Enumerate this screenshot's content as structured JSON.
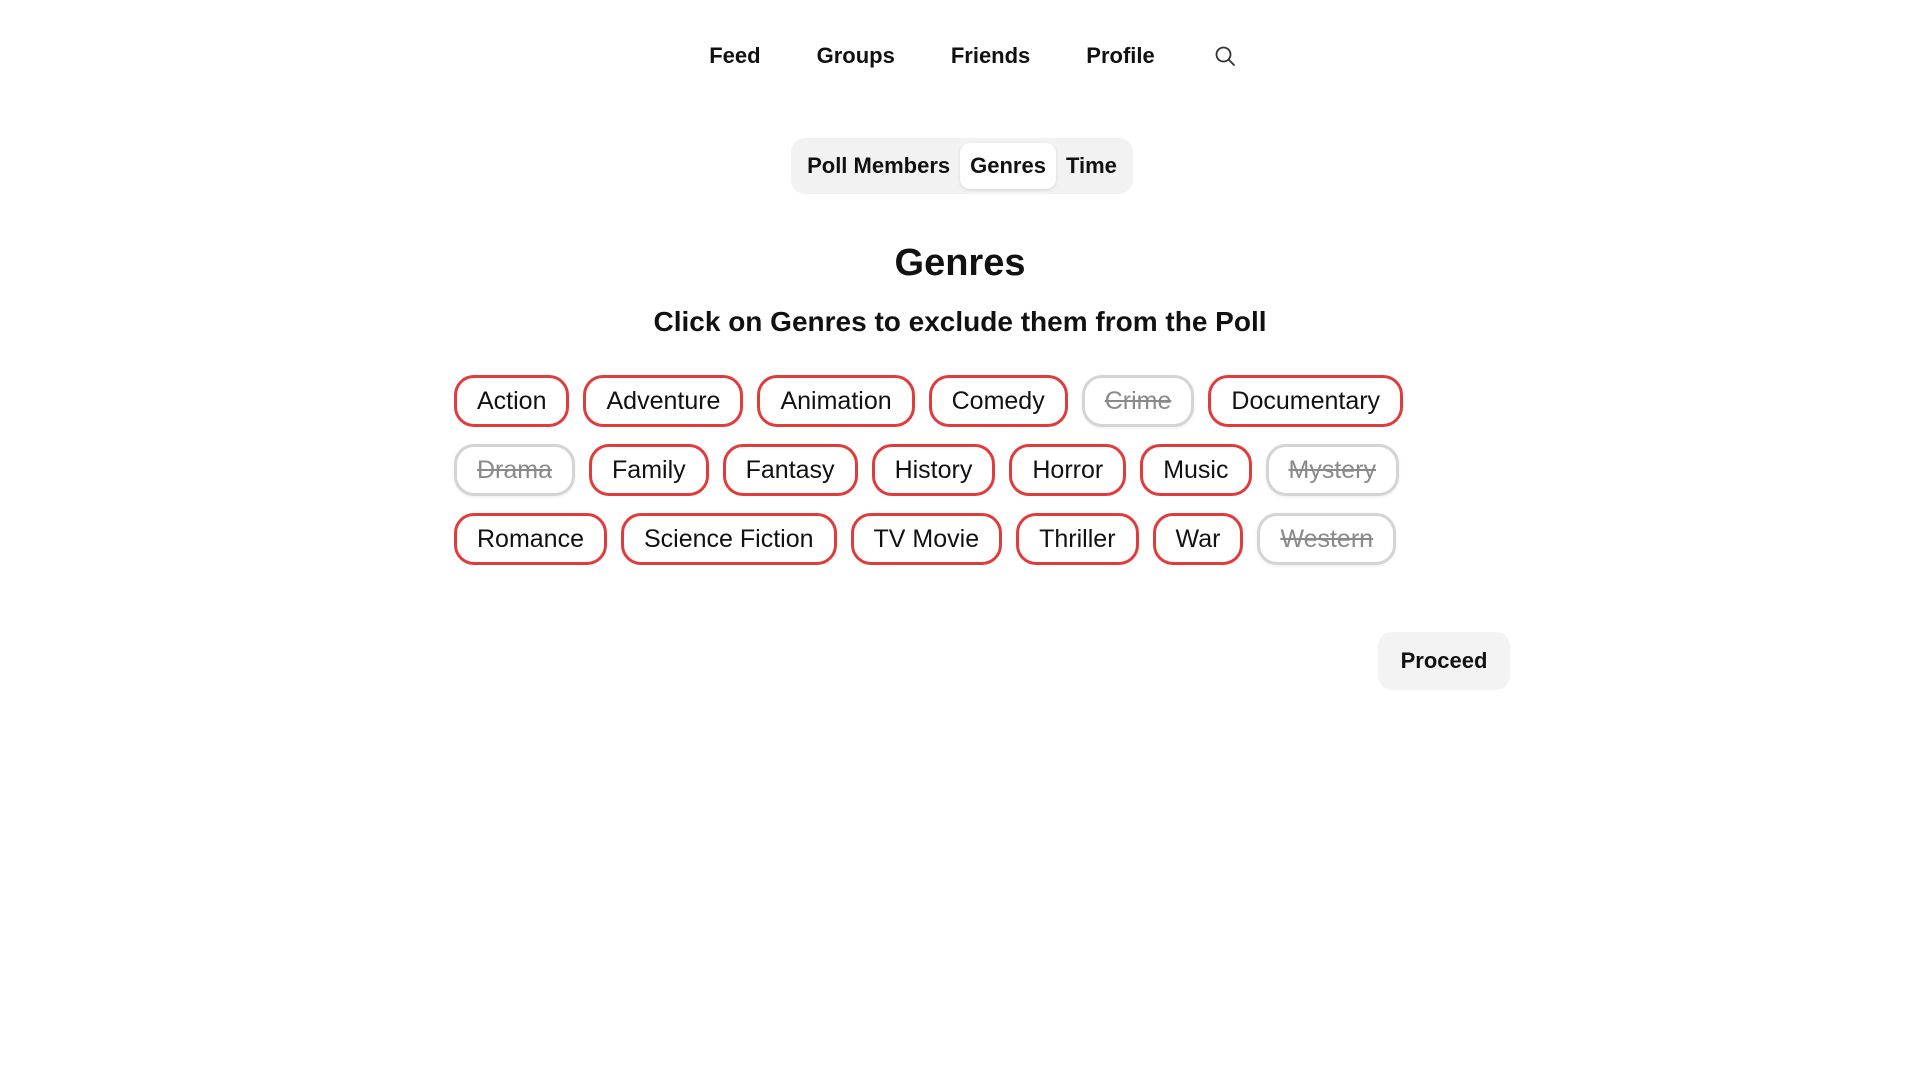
{
  "nav": {
    "items": [
      {
        "label": "Feed"
      },
      {
        "label": "Groups"
      },
      {
        "label": "Friends"
      },
      {
        "label": "Profile"
      }
    ],
    "search_icon": "search-icon"
  },
  "tabs": [
    {
      "label": "Poll Members",
      "active": false
    },
    {
      "label": "Genres",
      "active": true
    },
    {
      "label": "Time",
      "active": false
    }
  ],
  "page": {
    "title": "Genres",
    "subtitle": "Click on Genres to exclude them from the Poll"
  },
  "genres": {
    "rows": [
      [
        {
          "label": "Action",
          "excluded": false
        },
        {
          "label": "Adventure",
          "excluded": false
        },
        {
          "label": "Animation",
          "excluded": false
        },
        {
          "label": "Comedy",
          "excluded": false
        },
        {
          "label": "Crime",
          "excluded": true
        },
        {
          "label": "Documentary",
          "excluded": false
        }
      ],
      [
        {
          "label": "Drama",
          "excluded": true
        },
        {
          "label": "Family",
          "excluded": false
        },
        {
          "label": "Fantasy",
          "excluded": false
        },
        {
          "label": "History",
          "excluded": false
        },
        {
          "label": "Horror",
          "excluded": false
        },
        {
          "label": "Music",
          "excluded": false
        },
        {
          "label": "Mystery",
          "excluded": true
        }
      ],
      [
        {
          "label": "Romance",
          "excluded": false
        },
        {
          "label": "Science Fiction",
          "excluded": false
        },
        {
          "label": "TV Movie",
          "excluded": false
        },
        {
          "label": "Thriller",
          "excluded": false
        },
        {
          "label": "War",
          "excluded": false
        },
        {
          "label": "Western",
          "excluded": true
        }
      ]
    ]
  },
  "actions": {
    "proceed_label": "Proceed"
  },
  "colors": {
    "chip_active_border": "#e03c3c",
    "chip_excluded_border": "#d4d4d4",
    "chip_excluded_text": "#8a8a8a",
    "tabs_background": "#f2f2f2",
    "proceed_background": "#f3f3f3"
  }
}
